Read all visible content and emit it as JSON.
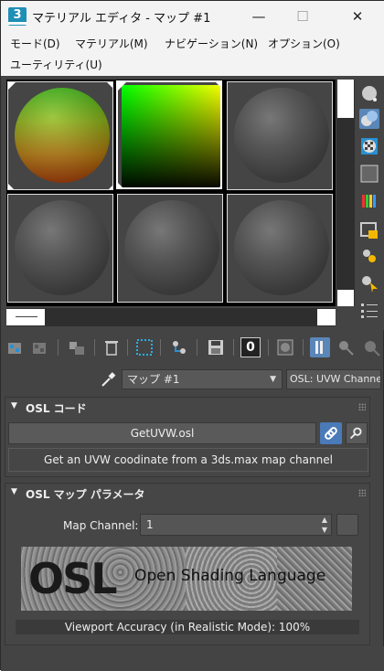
{
  "window": {
    "title": "マテリアル エディタ - マップ #1",
    "app_icon": "3",
    "minimize_glyph": "—",
    "maximize_glyph": "☐",
    "close_glyph": "✕"
  },
  "menubar": {
    "items": [
      "モード(D)",
      "マテリアル(M)",
      "ナビゲーション(N)",
      "オプション(O)",
      "ユーティリティ(U)"
    ]
  },
  "sample_slots": [
    {
      "type": "sphere-uvw",
      "selected": false
    },
    {
      "type": "square-uvw",
      "selected": true
    },
    {
      "type": "sphere-default",
      "selected": false
    },
    {
      "type": "sphere-default",
      "selected": false
    },
    {
      "type": "sphere-default",
      "selected": false
    },
    {
      "type": "sphere-default",
      "selected": false
    }
  ],
  "right_toolbar": {
    "icons": [
      "sample-type-sphere-icon",
      "backlight-icon",
      "background-checker-icon",
      "sample-uv-tiling-icon",
      "video-color-check-icon",
      "make-preview-icon",
      "options-icon",
      "select-by-material-icon",
      "material-map-navigator-icon"
    ],
    "active": "backlight-icon"
  },
  "bottom_toolbar": {
    "icons": [
      "get-material-icon",
      "put-to-scene-icon",
      "assign-to-selection-icon",
      "delete-icon",
      "make-unique-icon",
      "copy-icon",
      "save-to-library-icon",
      "material-id-channel-icon",
      "show-map-in-viewport-icon",
      "show-end-result-icon",
      "go-to-parent-icon",
      "go-forward-to-sibling-icon"
    ],
    "material_id": "0"
  },
  "map_row": {
    "map_name": "マップ #1",
    "map_type": "OSL: UVW Channel"
  },
  "rollouts": {
    "osl_code": {
      "title": "OSL コード",
      "file_button": "GetUVW.osl",
      "description": "Get an UVW coodinate from a 3ds.max map channel"
    },
    "osl_params": {
      "title": "OSL マップ パラメータ",
      "map_channel_label": "Map Channel:",
      "map_channel_value": "1",
      "logo_text": "OSL",
      "logo_tagline": "Open Shading Language",
      "viewport_accuracy": "Viewport Accuracy (in Realistic Mode): 100%"
    }
  },
  "colors": {
    "panel": "#464646",
    "accent": "#4a7ab8",
    "title_bar": "#f3f3f3"
  }
}
